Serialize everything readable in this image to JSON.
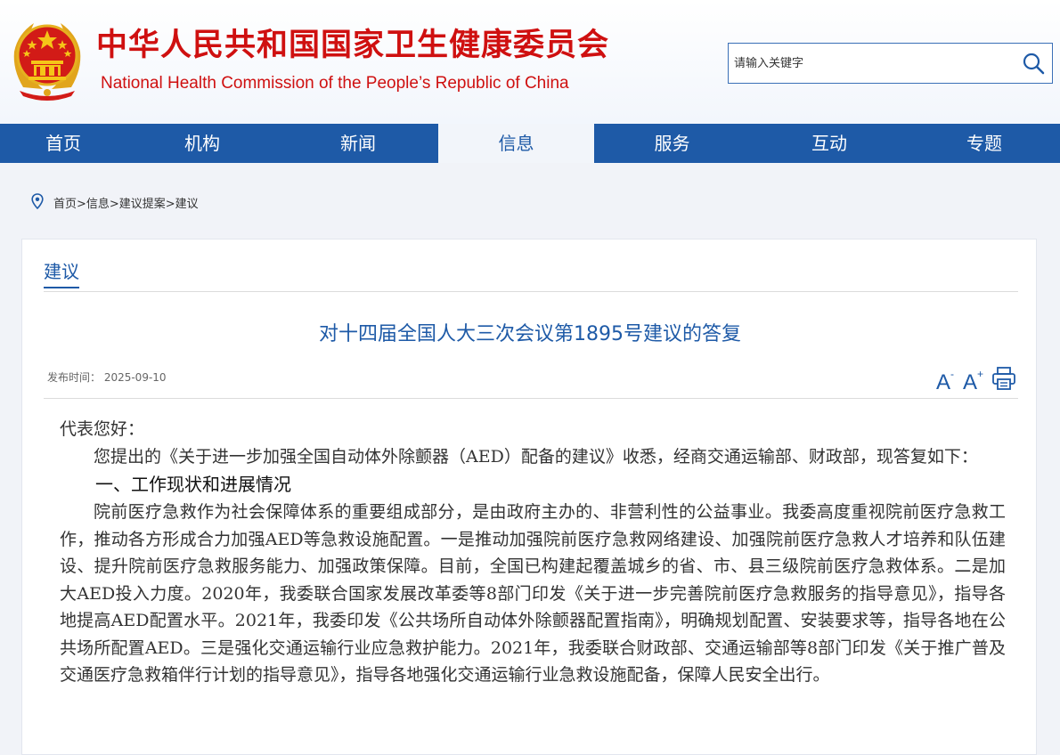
{
  "header": {
    "site_title": "中华人民共和国国家卫生健康委员会",
    "site_subtitle": "National Health Commission of the People’s  Republic of China"
  },
  "search": {
    "placeholder": "请输入关键字"
  },
  "nav": {
    "items": [
      {
        "label": "首页"
      },
      {
        "label": "机构"
      },
      {
        "label": "新闻"
      },
      {
        "label": "信息",
        "active": true
      },
      {
        "label": "服务"
      },
      {
        "label": "互动"
      },
      {
        "label": "专题"
      }
    ]
  },
  "breadcrumb": {
    "text": "首页>信息>建议提案>建议"
  },
  "section": {
    "tab_label": "建议"
  },
  "article": {
    "title": "对十四届全国人大三次会议第1895号建议的答复",
    "publish": "发布时间：  2025-09-10",
    "font_decrease": "A",
    "font_decrease_sign": "-",
    "font_increase": "A",
    "font_increase_sign": "+",
    "greeting": "代表您好：",
    "intro": "您提出的《关于进一步加强全国自动体外除颤器（AED）配备的建议》收悉，经商交通运输部、财政部，现答复如下：",
    "heading1": "一、工作现状和进展情况",
    "para1": "院前医疗急救作为社会保障体系的重要组成部分，是由政府主办的、非营利性的公益事业。我委高度重视院前医疗急救工作，推动各方形成合力加强AED等急救设施配置。一是推动加强院前医疗急救网络建设、加强院前医疗急救人才培养和队伍建设、提升院前医疗急救服务能力、加强政策保障。目前，全国已构建起覆盖城乡的省、市、县三级院前医疗急救体系。二是加大AED投入力度。2020年，我委联合国家发展改革委等8部门印发《关于进一步完善院前医疗急救服务的指导意见》，指导各地提高AED配置水平。2021年，我委印发《公共场所自动体外除颤器配置指南》，明确规划配置、安装要求等，指导各地在公共场所配置AED。三是强化交通运输行业应急救护能力。2021年，我委联合财政部、交通运输部等8部门印发《关于推广普及交通医疗急救箱伴行计划的指导意见》，指导各地强化交通运输行业急救设施配备，保障人民安全出行。"
  },
  "colors": {
    "brand_red": "#cf1010",
    "nav_blue": "#1e5aa7",
    "page_bg": "#f1f3f8"
  },
  "icons": [
    "national-emblem-icon",
    "search-icon",
    "location-pin-icon",
    "print-icon"
  ]
}
